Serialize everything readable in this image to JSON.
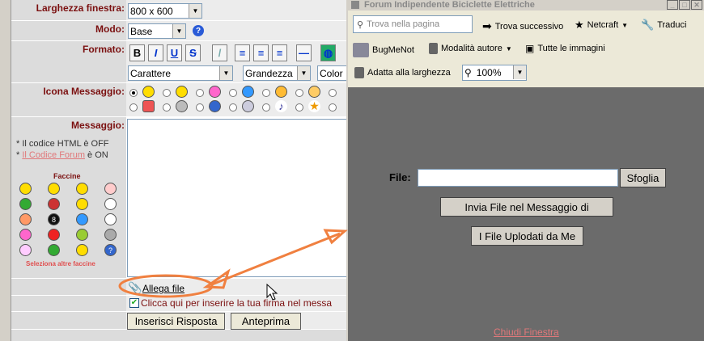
{
  "form": {
    "window_size_label": "Larghezza finestra:",
    "window_size_value": "800 x 600",
    "mode_label": "Modo:",
    "mode_value": "Base",
    "format_label": "Formato:",
    "format_buttons": [
      "B",
      "I",
      "U",
      "S"
    ],
    "font_select": "Carattere",
    "size_select": "Grandezza",
    "color_select": "Color",
    "icon_label": "Icona Messaggio:",
    "message_label": "Messaggio:",
    "html_note": "* Il codice HTML è OFF",
    "forum_code_prefix": "* ",
    "forum_code_link": "Il Codice Forum",
    "forum_code_suffix": " è ON",
    "smilies_title": "Faccine",
    "more_smilies": "Seleziona altre faccine",
    "attach_link": "Allega file",
    "signature_checkbox": "Clicca qui per inserire la tua firma nel messa",
    "reply_button": "Inserisci Risposta",
    "preview_button": "Anteprima"
  },
  "popup": {
    "title": "Forum Indipendente Biciclette Elettriche",
    "search_placeholder": "Trova nella pagina",
    "find_next": "Trova successivo",
    "netcraft": "Netcraft",
    "translate": "Traduci",
    "bugmenot": "BugMeNot",
    "author_mode": "Modalità autore",
    "all_images": "Tutte le immagini",
    "fit_width": "Adatta alla larghezza",
    "zoom": "100%",
    "file_label": "File:",
    "browse_button": "Sfoglia",
    "send_button": "Invia File nel Messaggio di",
    "uploaded_button": "I File Uplodati da Me",
    "close_link": "Chiudi Finestra"
  },
  "colors": {
    "label_text": "#7b1010",
    "annotation": "#f08040",
    "popup_bg": "#6b6b6b"
  }
}
